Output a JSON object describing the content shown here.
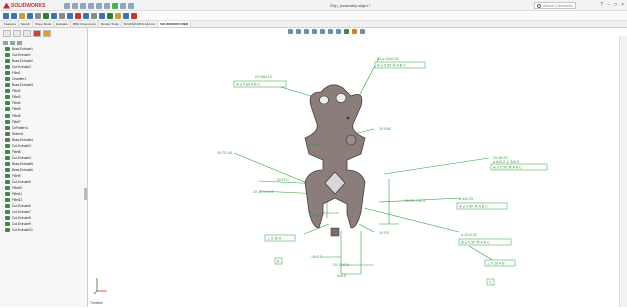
{
  "app": {
    "name": "SOLIDWORKS",
    "doc_title": "Grip_Assembly.sldprt *",
    "search_placeholder": "Search Commands"
  },
  "colors": {
    "gdt_green": "#2f9e3a",
    "part_fill": "#8b7d79",
    "accent": "#d9232a"
  },
  "tabs": [
    "Features",
    "Sketch",
    "Sheet Metal",
    "Evaluate",
    "MBD Dimensions",
    "Render Tools",
    "SOLIDWORKS Add-Ins",
    "SOLIDWORKS MBD"
  ],
  "active_tab": 7,
  "tree": [
    {
      "label": "Boss-Extrude1",
      "color": "#3d8a4a"
    },
    {
      "label": "Cut-Extrude1",
      "color": "#3d8a4a"
    },
    {
      "label": "Boss-Extrude2",
      "color": "#3d8a4a"
    },
    {
      "label": "Cut-Extrude2",
      "color": "#3d8a4a"
    },
    {
      "label": "Fillet1",
      "color": "#3d8a4a"
    },
    {
      "label": "Chamfer1",
      "color": "#3d8a4a"
    },
    {
      "label": "Boss-Extrude3",
      "color": "#3d8a4a"
    },
    {
      "label": "Fillet2",
      "color": "#3d8a4a"
    },
    {
      "label": "Fillet3",
      "color": "#3d8a4a"
    },
    {
      "label": "Fillet4",
      "color": "#3d8a4a"
    },
    {
      "label": "Fillet5",
      "color": "#3d8a4a"
    },
    {
      "label": "Fillet6",
      "color": "#3d8a4a"
    },
    {
      "label": "Fillet7",
      "color": "#3d8a4a"
    },
    {
      "label": "CirPattern1",
      "color": "#3d8a4a"
    },
    {
      "label": "Sketch1",
      "color": "#6a6a6a"
    },
    {
      "label": "Boss-Extrude4",
      "color": "#3d8a4a"
    },
    {
      "label": "Cut-Extrude3",
      "color": "#3d8a4a"
    },
    {
      "label": "Fillet8",
      "color": "#3d8a4a"
    },
    {
      "label": "Cut-Extrude4",
      "color": "#3d8a4a"
    },
    {
      "label": "Boss-Extrude5",
      "color": "#3d8a4a"
    },
    {
      "label": "Boss-Extrude6",
      "color": "#3d8a4a"
    },
    {
      "label": "Fillet9",
      "color": "#3d8a4a"
    },
    {
      "label": "Cut-Extrude5",
      "color": "#3d8a4a"
    },
    {
      "label": "Fillet10",
      "color": "#3d8a4a"
    },
    {
      "label": "Fillet11",
      "color": "#3d8a4a"
    },
    {
      "label": "Fillet12",
      "color": "#3d8a4a"
    },
    {
      "label": "Cut-Extrude6",
      "color": "#3d8a4a"
    },
    {
      "label": "Cut-Extrude7",
      "color": "#3d8a4a"
    },
    {
      "label": "Cut-Extrude8",
      "color": "#3d8a4a"
    },
    {
      "label": "Cut-Extrude9",
      "color": "#3d8a4a"
    },
    {
      "label": "Cut-Extrude10",
      "color": "#3d8a4a"
    }
  ],
  "annotations": {
    "t1": "2X ⌀ 15±0.25",
    "f1": "⊕ ⌀ 0.50 Ⓜ A B C",
    "t2": "2X M6x1.0",
    "f2": "⊕ ⌀ 0.80 A B C",
    "r40": "2X R40",
    "r30": "2X R30",
    "r1": "4X R1.45",
    "r17": "2X R17",
    "d12": "2X 12.0 ±0.5",
    "r3765": "2X 37.7 ±0.5",
    "x65": "2X 65",
    "r3": "2X R3",
    "tt1": "2X 26.25",
    "tt2": "⌀ 8±0.2 ↧ 3±0.5",
    "tt3": "⊕ ⌀ 0.50 Ⓜ A B C",
    "m1": "⌀ 4±0.25",
    "m2": "⊕ ⌀ 0.80 Ⓜ A B C",
    "b1": "⌀ 11±0.20",
    "b2": "⊕ ⌀ 0.50 Ⓜ A B C",
    "e1": "⊥ 0.10 A",
    "dB": "B",
    "l1": "15±0.5",
    "l2": "2X 14±0.5",
    "l3": "9±0.5",
    "f3": "⊥ 0.20 A B",
    "dC": "C",
    "view_label": "Trimetric"
  }
}
